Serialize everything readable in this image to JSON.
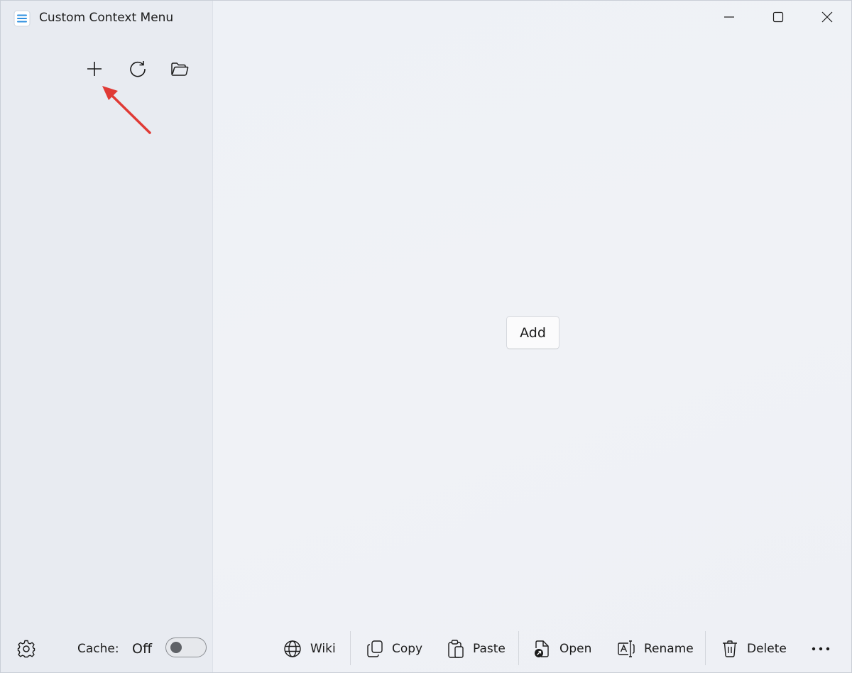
{
  "titlebar": {
    "title": "Custom Context Menu",
    "icons": [
      "hamburger-icon",
      "minimize-icon",
      "maximize-icon",
      "close-icon"
    ]
  },
  "sidebar": {
    "toolbar": [
      "add-icon",
      "refresh-icon",
      "folder-open-icon"
    ],
    "cache_label": "Cache:",
    "cache_state": "Off",
    "cache_enabled": false
  },
  "main": {
    "add_label": "Add"
  },
  "commandbar": {
    "wiki": "Wiki",
    "copy": "Copy",
    "paste": "Paste",
    "open": "Open",
    "rename": "Rename",
    "delete": "Delete",
    "more_icon": "more-icon"
  },
  "colors": {
    "accent": "#0a84d8",
    "annotation_arrow": "#e03a35",
    "background": "#eef1f6"
  }
}
